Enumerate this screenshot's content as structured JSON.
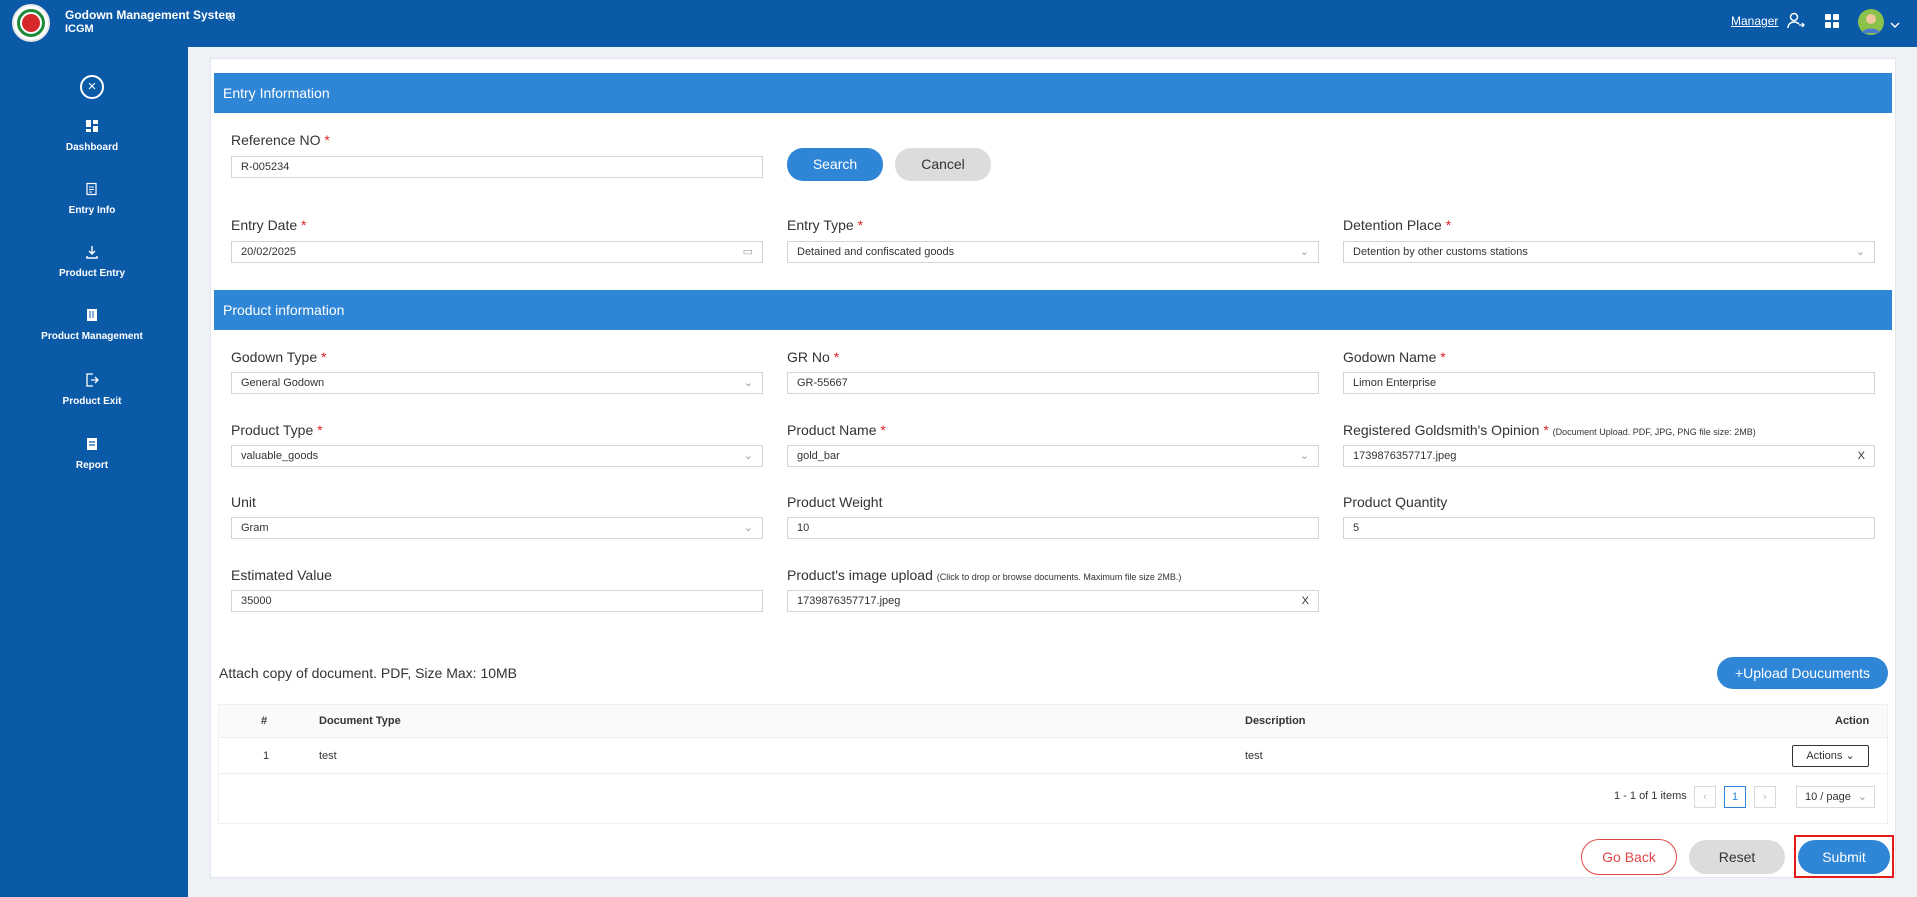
{
  "header": {
    "app_title": "Godown Management System",
    "app_subtitle": "ICGM",
    "collapse_icon": "«",
    "role_link": "Manager"
  },
  "sidebar": {
    "close_icon": "×",
    "items": [
      {
        "label": "Dashboard",
        "icon": "dashboard-icon"
      },
      {
        "label": "Entry Info",
        "icon": "entry-info-icon"
      },
      {
        "label": "Product Entry",
        "icon": "download-icon"
      },
      {
        "label": "Product Management",
        "icon": "book-icon"
      },
      {
        "label": "Product Exit",
        "icon": "exit-icon"
      },
      {
        "label": "Report",
        "icon": "report-icon"
      }
    ]
  },
  "entry_section": {
    "title": "Entry Information",
    "reference_no": {
      "label": "Reference NO",
      "value": "R-005234"
    },
    "search_label": "Search",
    "cancel_label": "Cancel",
    "entry_date": {
      "label": "Entry Date",
      "value": "20/02/2025"
    },
    "entry_type": {
      "label": "Entry Type",
      "value": "Detained and confiscated goods"
    },
    "detention_place": {
      "label": "Detention Place",
      "value": "Detention by other customs stations"
    }
  },
  "product_section": {
    "title": "Product information",
    "godown_type": {
      "label": "Godown Type",
      "value": "General Godown"
    },
    "gr_no": {
      "label": "GR No",
      "value": "GR-55667"
    },
    "godown_name": {
      "label": "Godown Name",
      "value": "Limon Enterprise"
    },
    "product_type": {
      "label": "Product Type",
      "value": "valuable_goods"
    },
    "product_name": {
      "label": "Product Name",
      "value": "gold_bar"
    },
    "goldsmith_opinion": {
      "label": "Registered Goldsmith's Opinion",
      "hint": "(Document Upload. PDF, JPG, PNG file size: 2MB)",
      "value": "1739876357717.jpeg"
    },
    "unit": {
      "label": "Unit",
      "value": "Gram"
    },
    "product_weight": {
      "label": "Product Weight",
      "value": "10"
    },
    "product_quantity": {
      "label": "Product Quantity",
      "value": "5"
    },
    "estimated_value": {
      "label": "Estimated Value",
      "value": "35000"
    },
    "image_upload": {
      "label": "Product's image upload",
      "hint": "(Click to drop or browse documents. Maximum file size 2MB.)",
      "value": "1739876357717.jpeg"
    }
  },
  "attachments": {
    "label": "Attach copy of document. PDF, Size Max: 10MB",
    "upload_label": "Upload Doucuments",
    "columns": [
      "#",
      "Document Type",
      "Description",
      "Action"
    ],
    "rows": [
      {
        "index": "1",
        "document_type": "test",
        "description": "test",
        "action": "Actions"
      }
    ],
    "pagination": {
      "summary": "1 - 1 of 1 items",
      "current_page": "1",
      "page_size": "10 / page"
    }
  },
  "footer": {
    "go_back_label": "Go Back",
    "reset_label": "Reset",
    "submit_label": "Submit"
  },
  "colors": {
    "primary": "#0b5aa8",
    "section_header": "#2f86d6",
    "required": "#e02424",
    "highlight_frame": "#e21b1b"
  }
}
